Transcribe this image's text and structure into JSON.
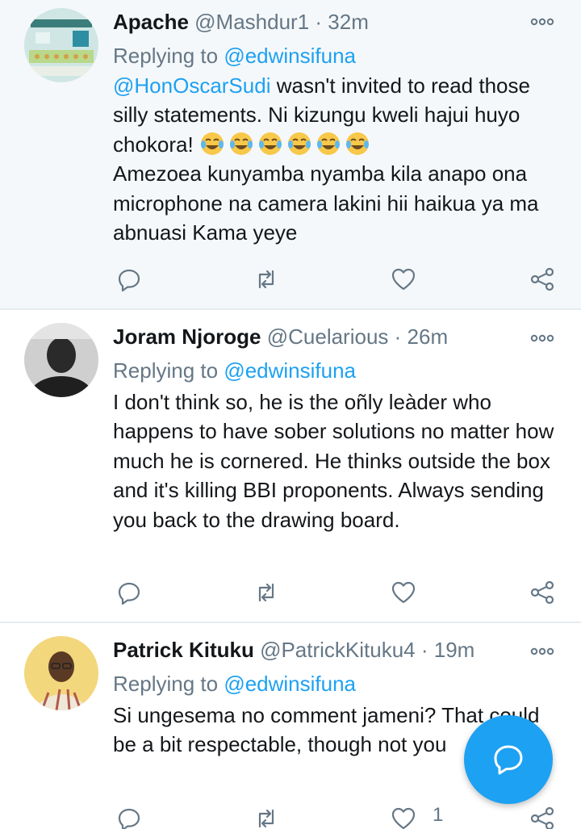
{
  "tweets": [
    {
      "name": "Apache",
      "handle": "@Mashdur1",
      "time": "· 32m",
      "replying_prefix": "Replying to ",
      "replying_to": "@edwinsifuna",
      "mention": "@HonOscarSudi",
      "text_before_emoji": " wasn't invited to read those silly statements. Ni kizungu kweli hajui huyo chokora! ",
      "text_after_emoji": "Amezoea kunyamba nyamba kila anapo ona microphone na camera lakini hii haikua ya ma abnuasi Kama yeye",
      "emoji": "face-with-tears-of-joy-icon",
      "emoji_count": 6
    },
    {
      "name": "Joram Njoroge",
      "handle": "@Cuelarious",
      "time": "· 26m",
      "replying_prefix": "Replying to ",
      "replying_to": "@edwinsifuna",
      "text": "I don't think so, he is the oñly leàder who happens to have sober solutions no matter how much he is cornered. He thinks outside the box and it's killing BBI proponents. Always sending you back to the drawing board."
    },
    {
      "name": "Patrick Kituku",
      "handle": "@PatrickKituku4",
      "time": "· 19m",
      "replying_prefix": "Replying to ",
      "replying_to": "@edwinsifuna",
      "text": "Si ungesema no comment jameni? That could be a bit respectable, though not you",
      "like_count": "1"
    }
  ],
  "colors": {
    "accent": "#1da1f2",
    "secondary_text": "#657786",
    "highlight_bg": "#f5f8fa",
    "icon": "#657786"
  },
  "icons": {
    "more": "more-options-icon",
    "reply": "reply-icon",
    "retweet": "retweet-icon",
    "like": "like-icon",
    "share": "share-icon",
    "compose": "compose-reply-icon"
  }
}
